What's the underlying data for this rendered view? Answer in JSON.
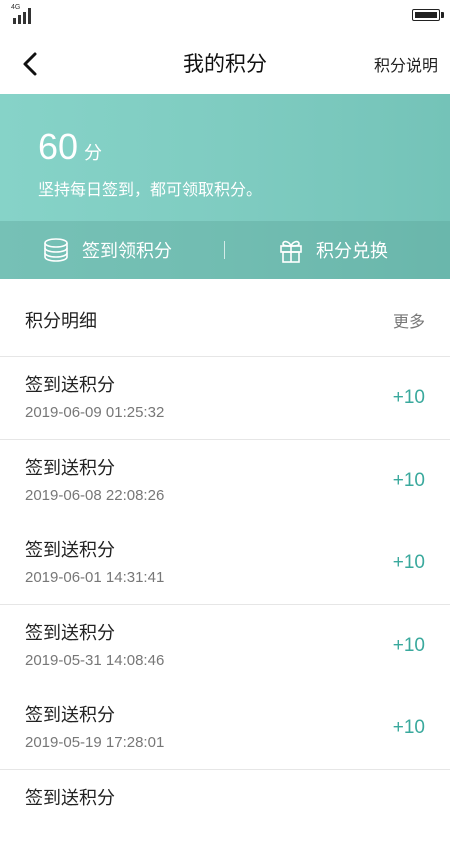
{
  "status_bar": {
    "network": "4G",
    "signal_icon": "signal-icon",
    "battery_icon": "battery-icon"
  },
  "nav": {
    "title": "我的积分",
    "help_label": "积分说明",
    "back_icon": "back-arrow-icon"
  },
  "header": {
    "points_value": "60",
    "points_unit": "分",
    "tagline": "坚持每日签到，都可领取积分。",
    "actions": [
      {
        "label": "签到领积分",
        "icon": "coins-stack-icon"
      },
      {
        "label": "积分兑换",
        "icon": "gift-icon"
      }
    ],
    "accent_color": "#7fccc1"
  },
  "details": {
    "title": "积分明细",
    "more_label": "更多",
    "amount_color": "#3aa99d",
    "rows": [
      {
        "title": "签到送积分",
        "time": "2019-06-09 01:25:32",
        "amount": "+10"
      },
      {
        "title": "签到送积分",
        "time": "2019-06-08 22:08:26",
        "amount": "+10"
      },
      {
        "title": "签到送积分",
        "time": "2019-06-01 14:31:41",
        "amount": "+10"
      },
      {
        "title": "签到送积分",
        "time": "2019-05-31 14:08:46",
        "amount": "+10"
      },
      {
        "title": "签到送积分",
        "time": "2019-05-19 17:28:01",
        "amount": "+10"
      },
      {
        "title": "签到送积分",
        "time": "",
        "amount": ""
      }
    ]
  }
}
